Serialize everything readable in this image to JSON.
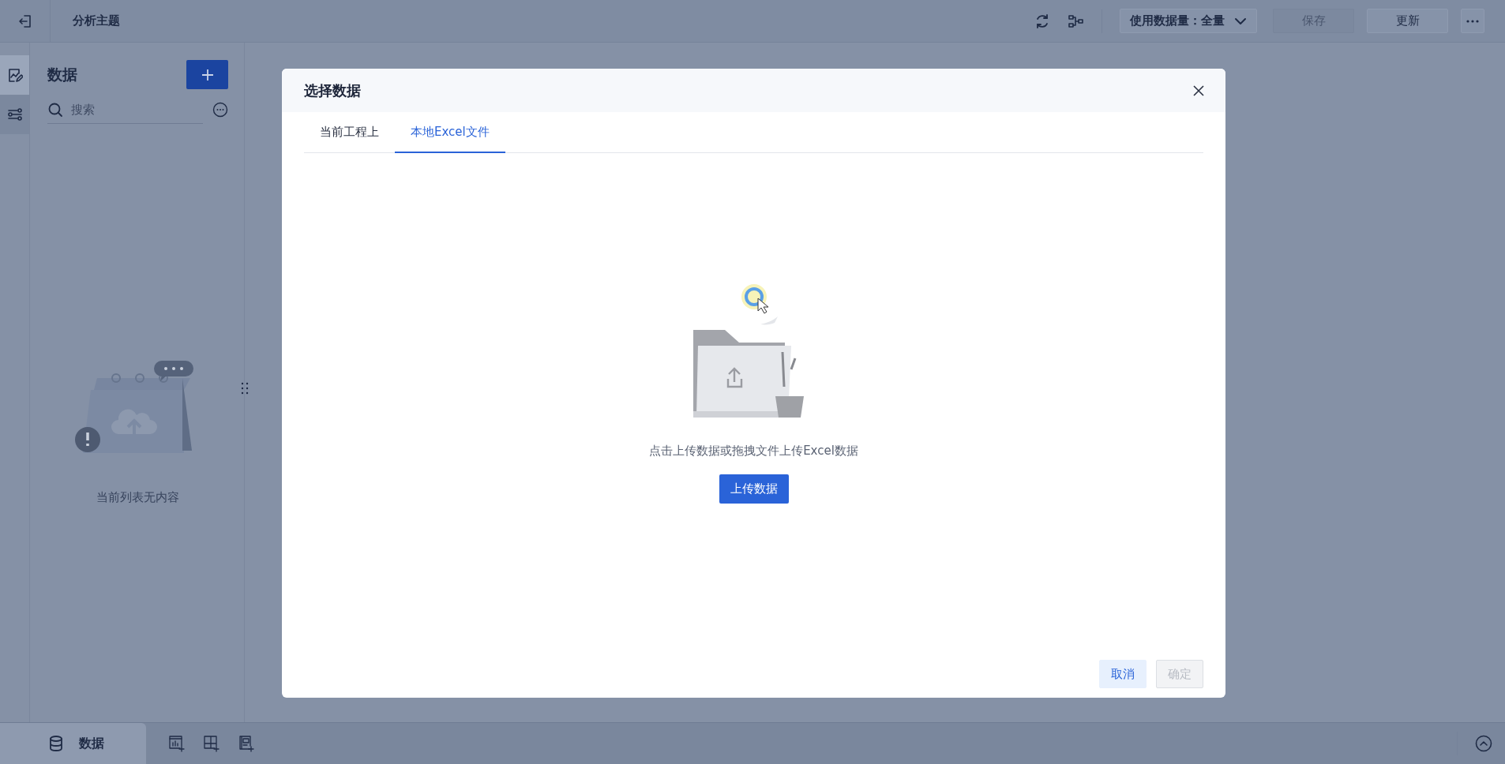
{
  "top_bar": {
    "title": "分析主题",
    "usage_select": {
      "label": "使用数据量：",
      "value": "全量"
    },
    "buttons": [
      {
        "label": "保存",
        "disabled": true
      },
      {
        "label": "更新",
        "disabled": false
      }
    ]
  },
  "rail": [
    {
      "kind": "chart-edit",
      "selected": true
    },
    {
      "kind": "filter",
      "selected": false
    }
  ],
  "data_panel": {
    "title": "数据",
    "search": {
      "placeholder": "搜索"
    },
    "empty_text": "当前列表无内容"
  },
  "modal": {
    "title": "选择数据",
    "tabs": [
      {
        "label": "当前工程上",
        "selected": false
      },
      {
        "label": "本地Excel文件",
        "selected": true
      }
    ],
    "upload_hint": "点击上传数据或拖拽文件上传Excel数据",
    "upload_button": "上传数据",
    "footer_buttons": [
      {
        "label": "取消",
        "kind": "secondary",
        "disabled": false
      },
      {
        "label": "确定",
        "kind": "primary",
        "disabled": true
      }
    ]
  },
  "bottom_bar": {
    "tab": {
      "label": "数据",
      "selected": true
    }
  }
}
